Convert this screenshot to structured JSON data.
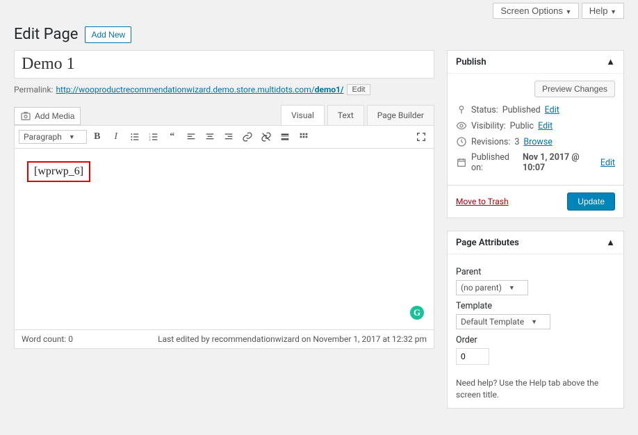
{
  "top": {
    "screen_options": "Screen Options",
    "help": "Help"
  },
  "header": {
    "title": "Edit Page",
    "add_new": "Add New"
  },
  "post": {
    "title": "Demo 1",
    "permalink_label": "Permalink:",
    "permalink_url": "http://wooproductrecommendationwizard.demo.store.multidots.com/",
    "permalink_slug": "demo1/",
    "permalink_edit": "Edit"
  },
  "editor": {
    "add_media": "Add Media",
    "tabs": {
      "visual": "Visual",
      "text": "Text",
      "page_builder": "Page Builder"
    },
    "format": "Paragraph",
    "content": "[wprwp_6]",
    "word_count_label": "Word count:",
    "word_count": "0",
    "last_edited": "Last edited by recommendationwizard on November 1, 2017 at 12:32 pm"
  },
  "publish": {
    "heading": "Publish",
    "preview": "Preview Changes",
    "status_label": "Status:",
    "status_value": "Published",
    "visibility_label": "Visibility:",
    "visibility_value": "Public",
    "revisions_label": "Revisions:",
    "revisions_value": "3",
    "revisions_browse": "Browse",
    "published_on_label": "Published on:",
    "published_on_value": "Nov 1, 2017 @ 10:07",
    "edit": "Edit",
    "trash": "Move to Trash",
    "update": "Update"
  },
  "attributes": {
    "heading": "Page Attributes",
    "parent_label": "Parent",
    "parent_value": "(no parent)",
    "template_label": "Template",
    "template_value": "Default Template",
    "order_label": "Order",
    "order_value": "0",
    "help": "Need help? Use the Help tab above the screen title."
  }
}
